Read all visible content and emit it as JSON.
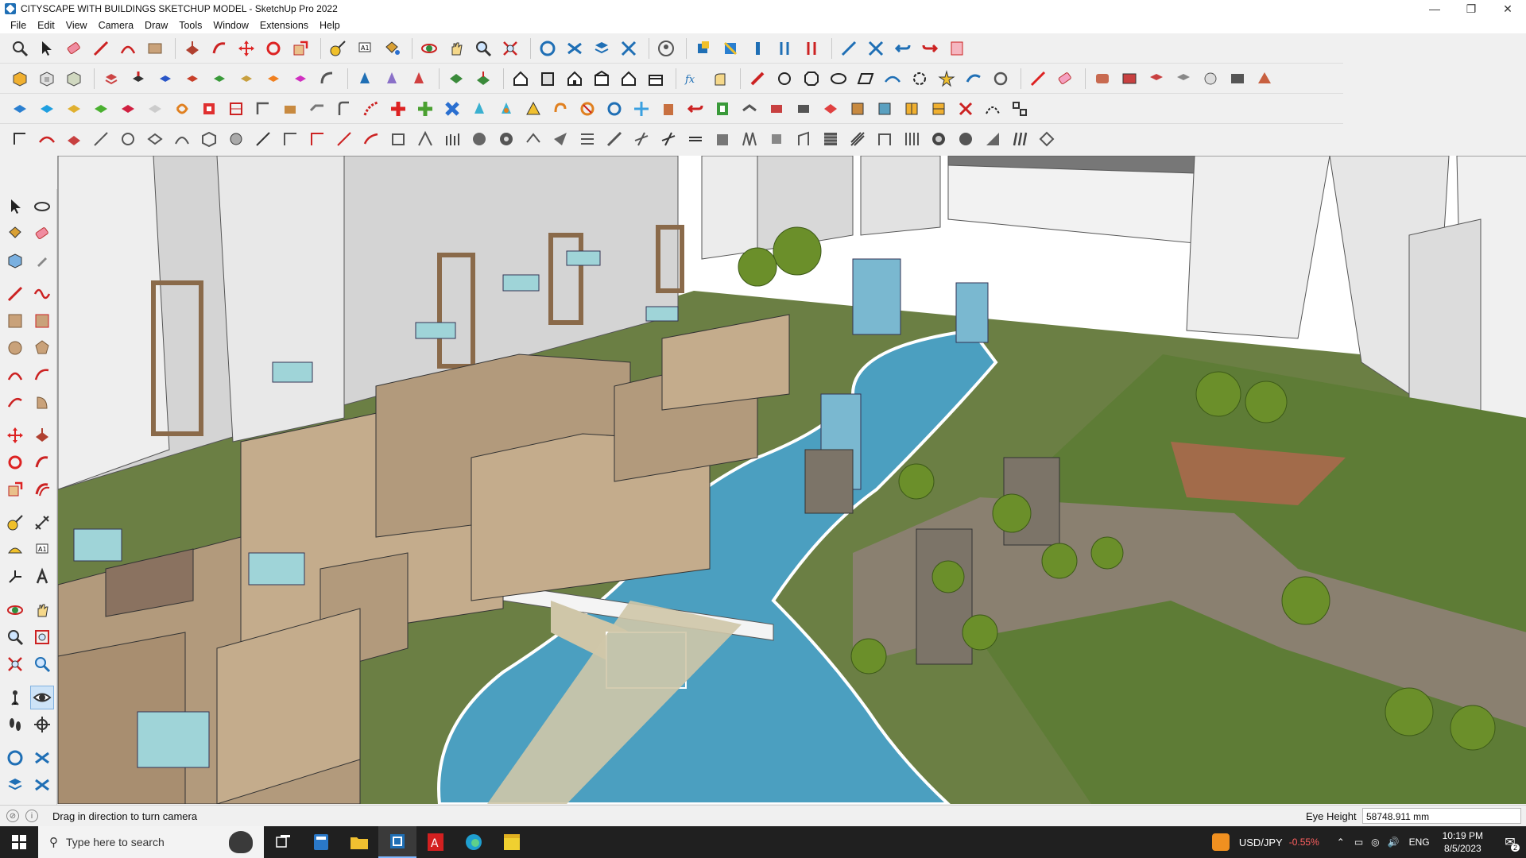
{
  "window": {
    "title": "CITYSCAPE WITH BUILDINGS SKETCHUP MODEL - SketchUp Pro 2022",
    "controls": [
      "—",
      "❐",
      "✕"
    ]
  },
  "menu": [
    "File",
    "Edit",
    "View",
    "Camera",
    "Draw",
    "Tools",
    "Window",
    "Extensions",
    "Help"
  ],
  "status": {
    "hint": "Drag in direction to turn camera",
    "eye_label": "Eye Height",
    "eye_value": "58748.911 mm"
  },
  "taskbar": {
    "search_placeholder": "Type here to search",
    "ticker_name": "USD/JPY",
    "ticker_change": "-0.55%",
    "language": "ENG",
    "time": "10:19 PM",
    "date": "8/5/2023",
    "notification_count": "2"
  },
  "colors": {
    "accent": "#d83b3b",
    "sky": "#ffffff",
    "water": "#4b9fc0",
    "grass": "#5b7a34",
    "building": "#b29a7c"
  }
}
